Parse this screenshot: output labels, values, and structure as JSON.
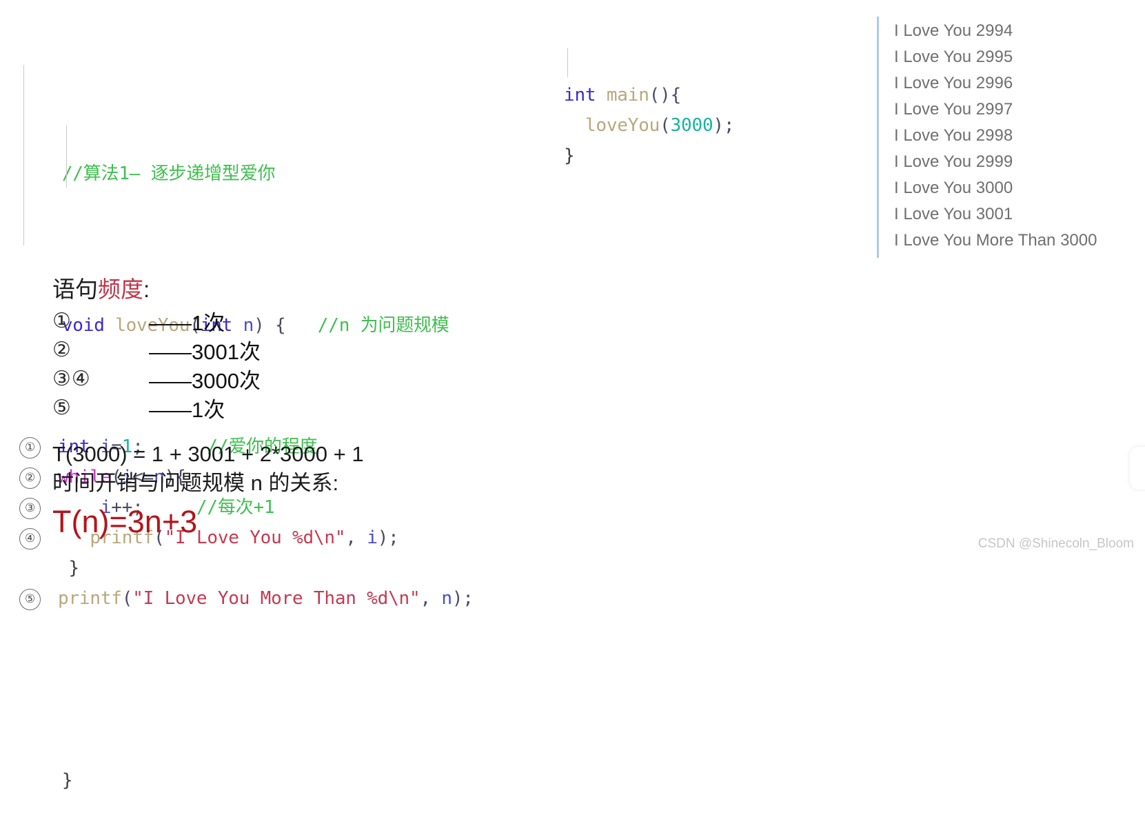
{
  "code_left": {
    "title_comment": "//算法1— 逐步递增型爱你",
    "signature": {
      "keyword": "void",
      "name": " loveYou",
      "paren_open": "(",
      "param_type": "int",
      "param_name": " n",
      "paren_close": ") {",
      "comment": "   //n 为问题规模"
    },
    "lines": [
      {
        "step": "①",
        "tokens": [
          {
            "text": "int",
            "cls": "kw"
          },
          {
            "text": " i",
            "cls": "var"
          },
          {
            "text": "=",
            "cls": "punc"
          },
          {
            "text": "1",
            "cls": "num"
          },
          {
            "text": ";",
            "cls": "punc"
          },
          {
            "text": "      //爱你的程度",
            "cls": "cmt"
          }
        ]
      },
      {
        "step": "②",
        "tokens": [
          {
            "text": "while",
            "cls": "kw-flow"
          },
          {
            "text": "(",
            "cls": "punc"
          },
          {
            "text": "i",
            "cls": "var"
          },
          {
            "text": "<=",
            "cls": "punc"
          },
          {
            "text": "n",
            "cls": "var"
          },
          {
            "text": "){",
            "cls": "punc"
          }
        ]
      },
      {
        "step": "③",
        "indent": "    ",
        "tokens": [
          {
            "text": "i",
            "cls": "var"
          },
          {
            "text": "++;",
            "cls": "punc"
          },
          {
            "text": "     //每次+1",
            "cls": "cmt"
          }
        ]
      },
      {
        "step": "④",
        "indent": "   ",
        "tokens": [
          {
            "text": "printf",
            "cls": "fn"
          },
          {
            "text": "(",
            "cls": "punc"
          },
          {
            "text": "\"I Love You %d\\n\"",
            "cls": "str"
          },
          {
            "text": ", ",
            "cls": "punc"
          },
          {
            "text": "i",
            "cls": "var"
          },
          {
            "text": ");",
            "cls": "punc"
          }
        ]
      },
      {
        "step": "",
        "indent": " ",
        "tokens": [
          {
            "text": "}",
            "cls": "plain"
          }
        ]
      },
      {
        "step": "⑤",
        "indent": "",
        "tokens": [
          {
            "text": "printf",
            "cls": "fn"
          },
          {
            "text": "(",
            "cls": "punc"
          },
          {
            "text": "\"I Love You More Than %d\\n\"",
            "cls": "str"
          },
          {
            "text": ", ",
            "cls": "punc"
          },
          {
            "text": "n",
            "cls": "var"
          },
          {
            "text": ");",
            "cls": "punc"
          }
        ]
      }
    ],
    "closing_brace": "}"
  },
  "code_main": {
    "lines": [
      {
        "indent": "",
        "tokens": [
          {
            "text": "int",
            "cls": "kw"
          },
          {
            "text": " main",
            "cls": "fn"
          },
          {
            "text": "(){",
            "cls": "punc"
          }
        ]
      },
      {
        "indent": "  ",
        "tokens": [
          {
            "text": "loveYou",
            "cls": "fn"
          },
          {
            "text": "(",
            "cls": "punc"
          },
          {
            "text": "3000",
            "cls": "num"
          },
          {
            "text": ");",
            "cls": "punc"
          }
        ]
      },
      {
        "indent": "",
        "tokens": [
          {
            "text": "}",
            "cls": "plain"
          }
        ]
      }
    ]
  },
  "console": {
    "lines": [
      "I Love You 2994",
      "I Love You 2995",
      "I Love You 2996",
      "I Love You 2997",
      "I Love You 2998",
      "I Love You 2999",
      "I Love You 3000",
      "I Love You 3001",
      "I Love You More Than 3000"
    ]
  },
  "analysis": {
    "freq_title_prefix": "语句",
    "freq_title_highlight": "频度",
    "freq_title_suffix": ":",
    "rows": [
      {
        "marks": "①",
        "count": "——1次"
      },
      {
        "marks": "②",
        "count": "——3001次"
      },
      {
        "marks": "③④",
        "count": "——3000次"
      },
      {
        "marks": "⑤",
        "count": "——1次"
      }
    ],
    "formula_numeric": "T(3000) = 1 + 3001 + 2*3000 + 1",
    "formula_relation": "时间开销与问题规模 n 的关系:",
    "formula_final": "T(n)=3n+3"
  },
  "watermark": "CSDN @Shinecoln_Bloom",
  "colors": {
    "keyword": "#3a2ad0",
    "keyword_flow": "#c832c8",
    "function": "#b9a77c",
    "number": "#17b3a0",
    "string": "#c43a52",
    "variable": "#4a4acd",
    "comment": "#3fbf4f",
    "console_text": "#6f6f6f",
    "console_border": "#aecbe8",
    "highlight_red": "#c2344a",
    "final_red": "#b4141b",
    "watermark": "#c6c6c6"
  }
}
